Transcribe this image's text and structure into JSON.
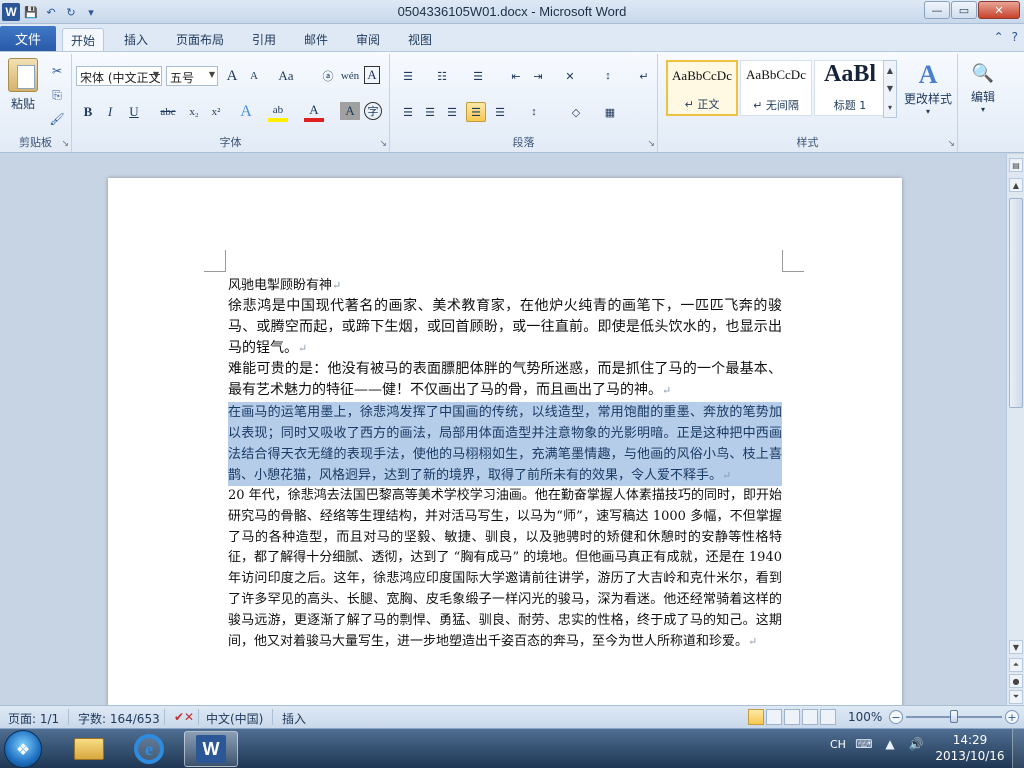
{
  "window": {
    "title": "0504336105W01.docx - Microsoft Word",
    "app_letter": "W",
    "controls": {
      "minimize": "—",
      "maximize": "▭",
      "close": "✕"
    }
  },
  "quick_access": {
    "save": "💾",
    "undo": "↶",
    "redo": "↻",
    "customize": "▾"
  },
  "tabs": {
    "file": "文件",
    "items": [
      "开始",
      "插入",
      "页面布局",
      "引用",
      "邮件",
      "审阅",
      "视图"
    ],
    "active": "开始",
    "help_icons": [
      "⌃",
      "?"
    ]
  },
  "ribbon": {
    "clipboard": {
      "label": "剪贴板",
      "paste": "粘贴",
      "icons": {
        "cut": "✂",
        "copy": "⎘",
        "format_painter": "🖌"
      }
    },
    "font": {
      "label": "字体",
      "font_name": "宋体 (中文正文)",
      "font_size": "五号",
      "grow": "A",
      "shrink": "A",
      "change_case": "Aa",
      "clear_format": "ⓐ",
      "phonetic": "wén",
      "char_border": "A",
      "bold": "B",
      "italic": "I",
      "underline": "U",
      "strike": "abc",
      "subscript": "x₂",
      "superscript": "x²",
      "text_effect": "A",
      "highlight": "ab",
      "font_color": "A",
      "char_shading": "A",
      "enclose": "字"
    },
    "paragraph": {
      "label": "段落",
      "bullets": "☰",
      "numbering": "☷",
      "multilevel": "☰",
      "dec_indent": "⇤",
      "inc_indent": "⇥",
      "asian_layout": "✕",
      "sort": "↕",
      "show_marks": "↵",
      "align_left": "☰",
      "align_center": "☰",
      "align_right": "☰",
      "justify": "☰",
      "distributed": "☰",
      "line_spacing": "↕",
      "shading": "◇",
      "borders": "▦"
    },
    "styles": {
      "label": "样式",
      "items": [
        {
          "sample": "AaBbCcDc",
          "name": "↵ 正文"
        },
        {
          "sample": "AaBbCcDc",
          "name": "↵ 无间隔"
        },
        {
          "sample": "AaBl",
          "name": "标题 1"
        }
      ],
      "change_styles": "更改样式",
      "change_styles_icon": "A"
    },
    "editing": {
      "label": "编辑",
      "icon": "🔍"
    }
  },
  "document": {
    "paragraphs": [
      "风驰电掣顾盼有神",
      "徐悲鸿是中国现代著名的画家、美术教育家，在他炉火纯青的画笔下，一匹匹飞奔的骏马、或腾空而起，或蹄下生烟，或回首顾盼，或一往直前。即使是低头饮水的，也显示出马的锃气。",
      "难能可贵的是：他没有被马的表面膘肥体胖的气势所迷惑，而是抓住了马的一个最基本、最有艺术魅力的特征——健！不仅画出了马的骨，而且画出了马的神。",
      "在画马的运笔用墨上，徐悲鸿发挥了中国画的传统，以线造型，常用饱酣的重墨、奔放的笔势加以表现；同时又吸收了西方的画法，局部用体面造型并注意物象的光影明暗。正是这种把中西画法结合得天衣无缝的表现手法，使他的马栩栩如生，充满笔墨情趣，与他画的风俗小鸟、枝上喜鹊、小憩花猫，风格迥异，达到了新的境界，取得了前所未有的效果，令人爱不释手。",
      "20 年代，徐悲鸿去法国巴黎高等美术学校学习油画。他在勤奋掌握人体素描技巧的同时，即开始研究马的骨骼、经络等生理结构，并对活马写生，以马为“师”，速写稿达 1000 多幅，不但掌握了马的各种造型，而且对马的坚毅、敏捷、驯良，以及驰骋时的矫健和休憩时的安静等性格特征，都了解得十分细腻、透彻，达到了 “胸有成马” 的境地。但他画马真正有成就，还是在 1940 年访问印度之后。这年，徐悲鸿应印度国际大学邀请前往讲学，游历了大吉岭和克什米尔，看到了许多罕见的高头、长腿、宽胸、皮毛象缎子一样闪光的骏马，深为看迷。他还经常骑着这样的骏马远游，更逐渐了解了马的剽悍、勇猛、驯良、耐劳、忠实的性格，终于成了马的知己。这期间，他又对着骏马大量写生，进一步地塑造出千姿百态的奔马，至今为世人所称道和珍爱。"
    ],
    "para_mark": "↵"
  },
  "statusbar": {
    "page": "页面: 1/1",
    "words": "字数: 164/653",
    "language": "中文(中国)",
    "mode": "插入",
    "zoom": "100%",
    "zoom_minus": "−",
    "zoom_plus": "+",
    "zoom_level": 1.0
  },
  "taskbar": {
    "start_icon": "❖",
    "ie_letter": "e",
    "word_letter": "W",
    "lang": "CH",
    "tray_icons": [
      "⌨",
      "▲",
      "🔊"
    ],
    "time": "14:29",
    "date": "2013/10/16"
  }
}
